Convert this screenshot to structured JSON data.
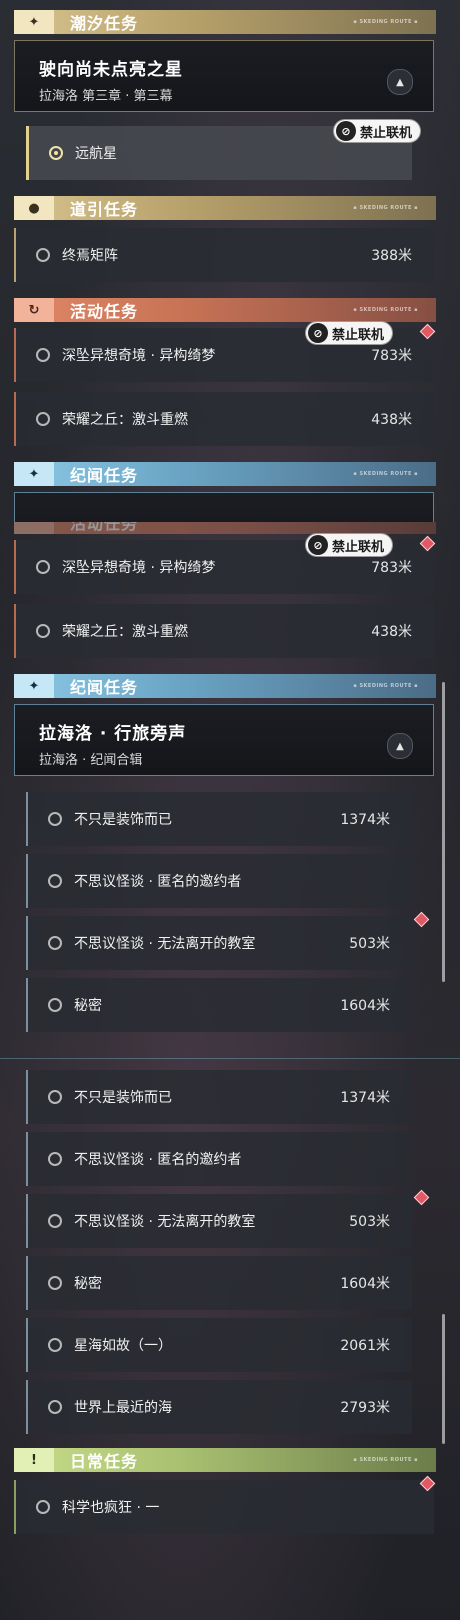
{
  "sections": {
    "tide": {
      "label": "潮汐任务",
      "icon": "sparkle-icon",
      "glyph": "✦"
    },
    "guide": {
      "label": "道引任务",
      "icon": "map-pin-icon",
      "glyph": "●"
    },
    "event": {
      "label": "活动任务",
      "icon": "event-icon",
      "glyph": "↻"
    },
    "chronicle": {
      "label": "纪闻任务",
      "icon": "sparkle-icon",
      "glyph": "✦"
    },
    "daily": {
      "label": "日常任务",
      "icon": "exclamation-icon",
      "glyph": "!"
    }
  },
  "section_deco": "▪ SKEDING ROUTE ▪",
  "tide_card": {
    "title": "驶向尚未点亮之星",
    "subtitle": "拉海洛 第三章 · 第三幕",
    "collapse_glyph": "▲"
  },
  "chronicle_card": {
    "title": "拉海洛 · 行旅旁声",
    "subtitle": "拉海洛 · 纪闻合辑",
    "collapse_glyph": "▲"
  },
  "no_coop": {
    "label": "禁止联机",
    "glyph": "⊘"
  },
  "tide_quest": {
    "title": "远航星"
  },
  "guide_quest": {
    "title": "终焉矩阵",
    "distance": "388米"
  },
  "event_quests": [
    {
      "title": "深坠异想奇境 · 异构绮梦",
      "distance": "783米"
    },
    {
      "title": "荣耀之丘：激斗重燃",
      "distance": "438米"
    }
  ],
  "chronicle_quests": [
    {
      "title": "不只是装饰而已",
      "distance": "1374米"
    },
    {
      "title": "不思议怪谈 · 匿名的邀约者",
      "distance": ""
    },
    {
      "title": "不思议怪谈 · 无法离开的教室",
      "distance": "503米"
    },
    {
      "title": "秘密",
      "distance": "1604米"
    },
    {
      "title": "星海如故（一）",
      "distance": "2061米"
    },
    {
      "title": "世界上最近的海",
      "distance": "2793米"
    }
  ],
  "daily_quest": {
    "title": "科学也疯狂 · 一",
    "distance": ""
  },
  "partial_header": "活动任务"
}
